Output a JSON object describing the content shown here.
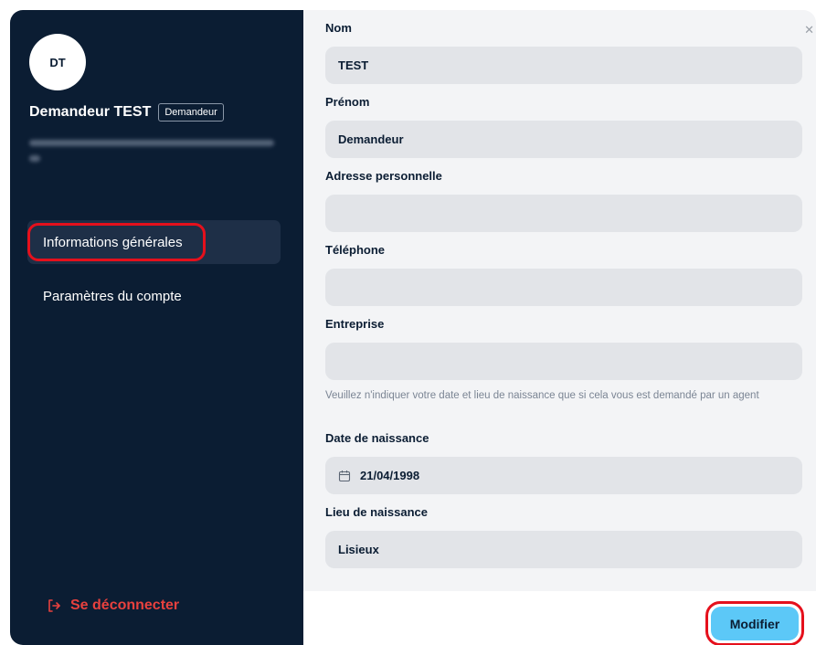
{
  "user": {
    "initials": "DT",
    "name": "Demandeur TEST",
    "role": "Demandeur"
  },
  "sidebar": {
    "items": [
      {
        "label": "Informations générales",
        "active": true
      },
      {
        "label": "Paramètres du compte",
        "active": false
      }
    ],
    "logout_label": "Se déconnecter"
  },
  "form": {
    "nom": {
      "label": "Nom",
      "value": "TEST"
    },
    "prenom": {
      "label": "Prénom",
      "value": "Demandeur"
    },
    "adresse": {
      "label": "Adresse personnelle",
      "value": ""
    },
    "telephone": {
      "label": "Téléphone",
      "value": ""
    },
    "entreprise": {
      "label": "Entreprise",
      "value": ""
    },
    "note": "Veuillez n'indiquer votre date et lieu de naissance que si cela vous est demandé par un agent",
    "date_naissance": {
      "label": "Date de naissance",
      "value": "21/04/1998"
    },
    "lieu_naissance": {
      "label": "Lieu de naissance",
      "value": "Lisieux"
    }
  },
  "footer": {
    "modify_label": "Modifier"
  },
  "colors": {
    "sidebar_bg": "#0b1d33",
    "accent": "#5cc8f7",
    "logout": "#e8413e",
    "highlight": "#e5101c"
  }
}
